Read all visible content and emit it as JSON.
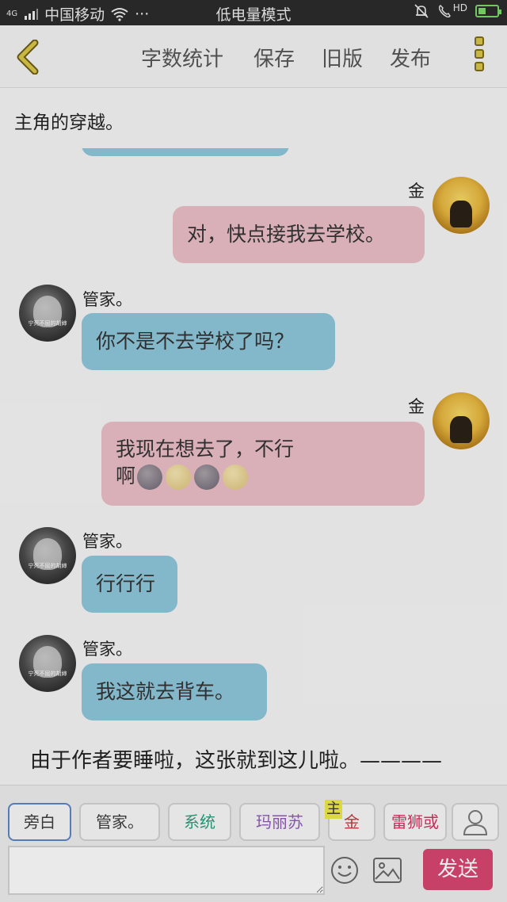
{
  "status_bar": {
    "network": "4G",
    "carrier": "中国移动",
    "more": "···",
    "mode": "低电量模式",
    "hd": "HD",
    "battery_percent": 40
  },
  "toolbar": {
    "word_count": "字数统计",
    "save": "保存",
    "old_version": "旧版",
    "publish": "发布"
  },
  "title": "主角的穿越。",
  "messages": [
    {
      "side": "right",
      "name": "金",
      "text": "对，快点接我去学校。",
      "color": "pink"
    },
    {
      "side": "left",
      "name": "管家。",
      "text": "你不是不去学校了吗？",
      "color": "blue"
    },
    {
      "side": "right",
      "name": "金",
      "text_line1": "我现在想去了，不行",
      "text_line2": "啊",
      "color": "pink"
    },
    {
      "side": "left",
      "name": "管家。",
      "text": "行行行",
      "color": "blue"
    },
    {
      "side": "left",
      "name": "管家。",
      "text": "我这就去背车。",
      "color": "blue"
    }
  ],
  "avatar_caption": "宁死不屈的胡婶",
  "footnote": "由于作者要睡啦，这张就到这儿啦。————",
  "characters": [
    {
      "label": "旁白",
      "color": "#3d3d3d",
      "selected": true
    },
    {
      "label": "管家。",
      "color": "#3d3d3d"
    },
    {
      "label": "系统",
      "color": "#2b9b7a"
    },
    {
      "label": "玛丽苏",
      "color": "#8e5ab3"
    },
    {
      "label": "金",
      "color": "#c03a3a",
      "tag": "主"
    },
    {
      "label": "雷狮或",
      "color": "#d0345f"
    }
  ],
  "input": {
    "value": "",
    "placeholder": ""
  },
  "send_label": "发送",
  "colors": {
    "send": "#d3446f",
    "bubble_blue": "#8cc4d8",
    "bubble_pink": "#e8bcc4"
  }
}
